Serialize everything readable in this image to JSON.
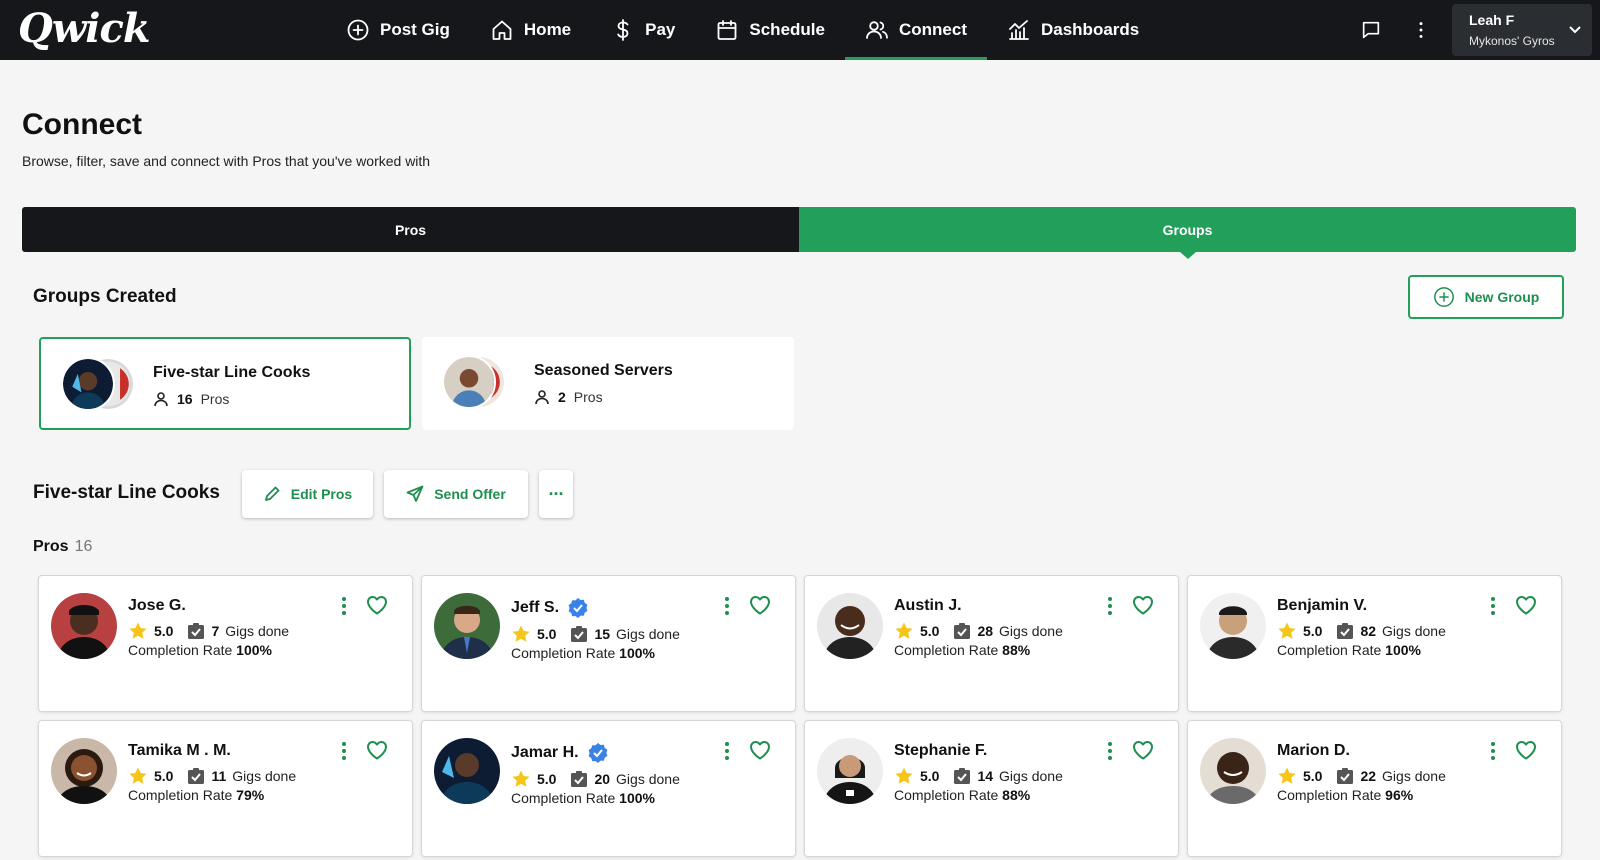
{
  "brand": {
    "logo": "Qwick",
    "accent": "#22a05a",
    "nav_bg": "#15171a"
  },
  "nav": {
    "items": [
      {
        "label": "Post Gig",
        "icon": "plus-circle-icon"
      },
      {
        "label": "Home",
        "icon": "home-icon"
      },
      {
        "label": "Pay",
        "icon": "dollar-icon"
      },
      {
        "label": "Schedule",
        "icon": "calendar-icon"
      },
      {
        "label": "Connect",
        "icon": "users-icon",
        "active": true
      },
      {
        "label": "Dashboards",
        "icon": "chart-icon"
      }
    ],
    "user": {
      "name": "Leah F",
      "org": "Mykonos' Gyros"
    }
  },
  "page": {
    "title": "Connect",
    "subtitle": "Browse, filter, save and connect with Pros that you've worked with"
  },
  "tabs": {
    "pros": "Pros",
    "groups": "Groups",
    "active": "Groups"
  },
  "groups_section": {
    "title": "Groups Created",
    "new_group_label": "New Group",
    "groups": [
      {
        "name": "Five-star Line Cooks",
        "count": "16",
        "count_label": "Pros",
        "selected": true
      },
      {
        "name": "Seasoned Servers",
        "count": "2",
        "count_label": "Pros",
        "selected": false
      }
    ]
  },
  "selected_group": {
    "title": "Five-star Line Cooks",
    "edit_label": "Edit Pros",
    "send_label": "Send Offer",
    "more_label": "···",
    "pros_label": "Pros",
    "pros_count": "16"
  },
  "pros": [
    {
      "name": "Jose G.",
      "rating": "5.0",
      "gigs": "7",
      "gigs_label": "Gigs done",
      "rate_label": "Completion Rate",
      "rate": "100%",
      "verified": false
    },
    {
      "name": "Jeff S.",
      "rating": "5.0",
      "gigs": "15",
      "gigs_label": "Gigs done",
      "rate_label": "Completion Rate",
      "rate": "100%",
      "verified": true
    },
    {
      "name": "Austin J.",
      "rating": "5.0",
      "gigs": "28",
      "gigs_label": "Gigs done",
      "rate_label": "Completion Rate",
      "rate": "88%",
      "verified": false
    },
    {
      "name": "Benjamin V.",
      "rating": "5.0",
      "gigs": "82",
      "gigs_label": "Gigs done",
      "rate_label": "Completion Rate",
      "rate": "100%",
      "verified": false
    },
    {
      "name": "Tamika M . M.",
      "rating": "5.0",
      "gigs": "11",
      "gigs_label": "Gigs done",
      "rate_label": "Completion Rate",
      "rate": "79%",
      "verified": false
    },
    {
      "name": "Jamar H.",
      "rating": "5.0",
      "gigs": "20",
      "gigs_label": "Gigs done",
      "rate_label": "Completion Rate",
      "rate": "100%",
      "verified": true
    },
    {
      "name": "Stephanie F.",
      "rating": "5.0",
      "gigs": "14",
      "gigs_label": "Gigs done",
      "rate_label": "Completion Rate",
      "rate": "88%",
      "verified": false
    },
    {
      "name": "Marion D.",
      "rating": "5.0",
      "gigs": "22",
      "gigs_label": "Gigs done",
      "rate_label": "Completion Rate",
      "rate": "96%",
      "verified": false
    }
  ]
}
